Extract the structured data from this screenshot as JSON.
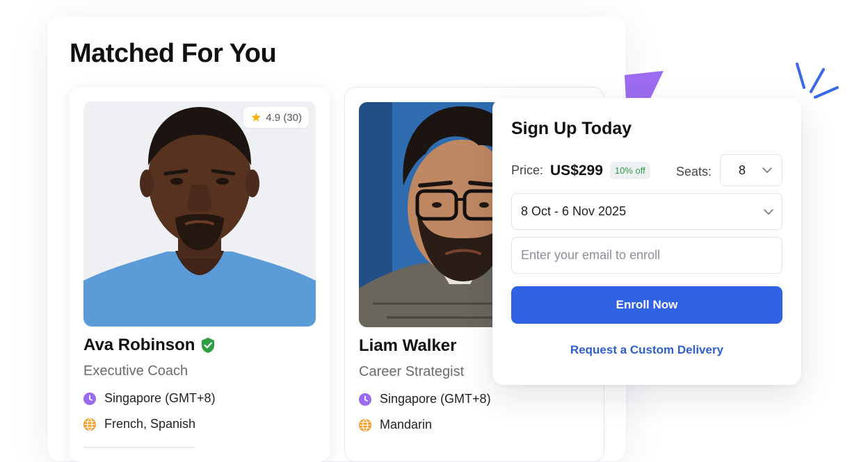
{
  "page": {
    "title": "Matched For You"
  },
  "colors": {
    "accent_blue": "#3062e4",
    "link_blue": "#2e5fd1",
    "verified_green": "#2f9e44",
    "discount_green": "#2e9b4a",
    "star_yellow": "#f5b301",
    "clock_purple": "#9b6cf0",
    "globe_orange": "#f39a1e",
    "deco_purple": "#9d6cf0",
    "deco_blue": "#3a68e8"
  },
  "coaches": [
    {
      "name": "Ava Robinson",
      "role": "Executive Coach",
      "rating": "4.9 (30)",
      "verified": true,
      "timezone": "Singapore (GMT+8)",
      "languages": "French, Spanish",
      "icons": [
        "star-icon",
        "verified-icon",
        "clock-icon",
        "globe-icon"
      ]
    },
    {
      "name": "Liam Walker",
      "role": "Career Strategist",
      "timezone": "Singapore (GMT+8)",
      "languages": "Mandarin",
      "icons": [
        "clock-icon",
        "globe-icon"
      ]
    }
  ],
  "signup": {
    "title": "Sign Up Today",
    "price_label": "Price:",
    "price_value": "US$299",
    "discount": "10% off",
    "seats_label": "Seats:",
    "seats_value": "8",
    "date_range": "8 Oct - 6 Nov 2025",
    "email_placeholder": "Enter your email to enroll",
    "enroll_label": "Enroll Now",
    "custom_delivery_label": "Request a Custom Delivery"
  }
}
